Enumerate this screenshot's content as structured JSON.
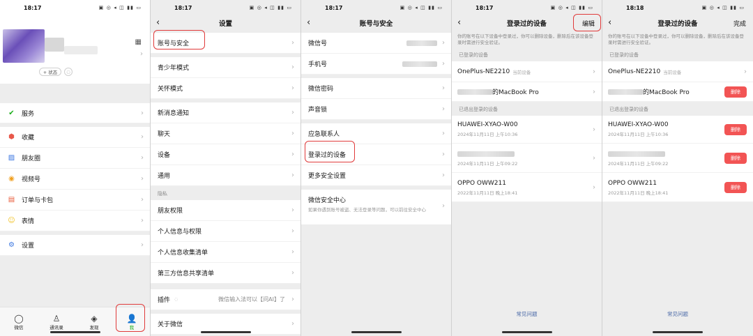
{
  "screen1": {
    "time": "18:17",
    "status_button": "+ 状态",
    "menu": [
      {
        "label": "服务",
        "icon": "service-check-icon",
        "color": "#1aad19"
      },
      {
        "label": "收藏",
        "icon": "favorites-cube-icon",
        "color": "#f0a020"
      },
      {
        "label": "朋友圈",
        "icon": "moments-picture-icon",
        "color": "#3a76e0"
      },
      {
        "label": "视频号",
        "icon": "channels-play-icon",
        "color": "#f0a020"
      },
      {
        "label": "订单与卡包",
        "icon": "orders-wallet-icon",
        "color": "#e85a3a"
      },
      {
        "label": "表情",
        "icon": "sticker-smiley-icon",
        "color": "#f0c020"
      },
      {
        "label": "设置",
        "icon": "settings-gear-icon",
        "color": "#3a76e0"
      }
    ],
    "tabs": [
      "微信",
      "通讯录",
      "发现",
      "我"
    ]
  },
  "screen2": {
    "time": "18:17",
    "title": "设置",
    "group1": [
      "账号与安全"
    ],
    "group2": [
      "青少年模式",
      "关怀模式"
    ],
    "group3": [
      "新消息通知",
      "聊天",
      "设备",
      "通用"
    ],
    "privacy_label": "隐私",
    "group4": [
      "朋友权限",
      "个人信息与权限",
      "个人信息收集清单",
      "第三方信息共享清单"
    ],
    "plugin_label": "插件",
    "plugin_value": "微信输入法可以【问AI】了",
    "about_label": "关于微信"
  },
  "screen3": {
    "time": "18:17",
    "title": "账号与安全",
    "group1": [
      "微信号",
      "手机号"
    ],
    "group2": [
      "微信密码",
      "声音锁"
    ],
    "group3": [
      "应急联系人",
      "登录过的设备",
      "更多安全设置"
    ],
    "security_center": "微信安全中心",
    "security_desc": "如果你遇到账号被盗、无法登录等问题，可以前往安全中心"
  },
  "screen4": {
    "time": "18:17",
    "title": "登录过的设备",
    "action": "编辑",
    "desc": "你的账号在以下设备中登录过，你可以删除设备，删除后在该设备登录时需进行安全验证。",
    "logged_in_label": "已登录的设备",
    "current_device": "OnePlus-NE2210",
    "current_tag": "当前设备",
    "macbook": "的MacBook Pro",
    "logged_out_label": "已退出登录的设备",
    "devices": [
      {
        "name": "HUAWEI-XYAO-W00",
        "time": "2024年11月11日 上午10:36"
      },
      {
        "name": "",
        "time": "2024年11月11日 上午09:22"
      },
      {
        "name": "OPPO OWW211",
        "time": "2022年11月11日 晚上18:41"
      }
    ],
    "faq": "常见问题"
  },
  "screen5": {
    "time": "18:18",
    "title": "登录过的设备",
    "action": "完成",
    "desc": "你的账号在以下设备中登录过，你可以删除设备，删除后在该设备登录时需进行安全验证。",
    "logged_in_label": "已登录的设备",
    "current_device": "OnePlus-NE2210",
    "current_tag": "当前设备",
    "macbook": "的MacBook Pro",
    "logged_out_label": "已退出登录的设备",
    "delete_label": "删除",
    "devices": [
      {
        "name": "HUAWEI-XYAO-W00",
        "time": "2024年11月11日 上午10:36"
      },
      {
        "name": "",
        "time": "2024年11月11日 上午09:22"
      },
      {
        "name": "OPPO OWW211",
        "time": "2022年11月11日 晚上18:41"
      }
    ],
    "faq": "常见问题"
  },
  "colors": {
    "accent_green": "#1aad19",
    "highlight_red": "#e03a3a",
    "delete_red": "#f25454",
    "link_blue": "#4b6aa8"
  }
}
